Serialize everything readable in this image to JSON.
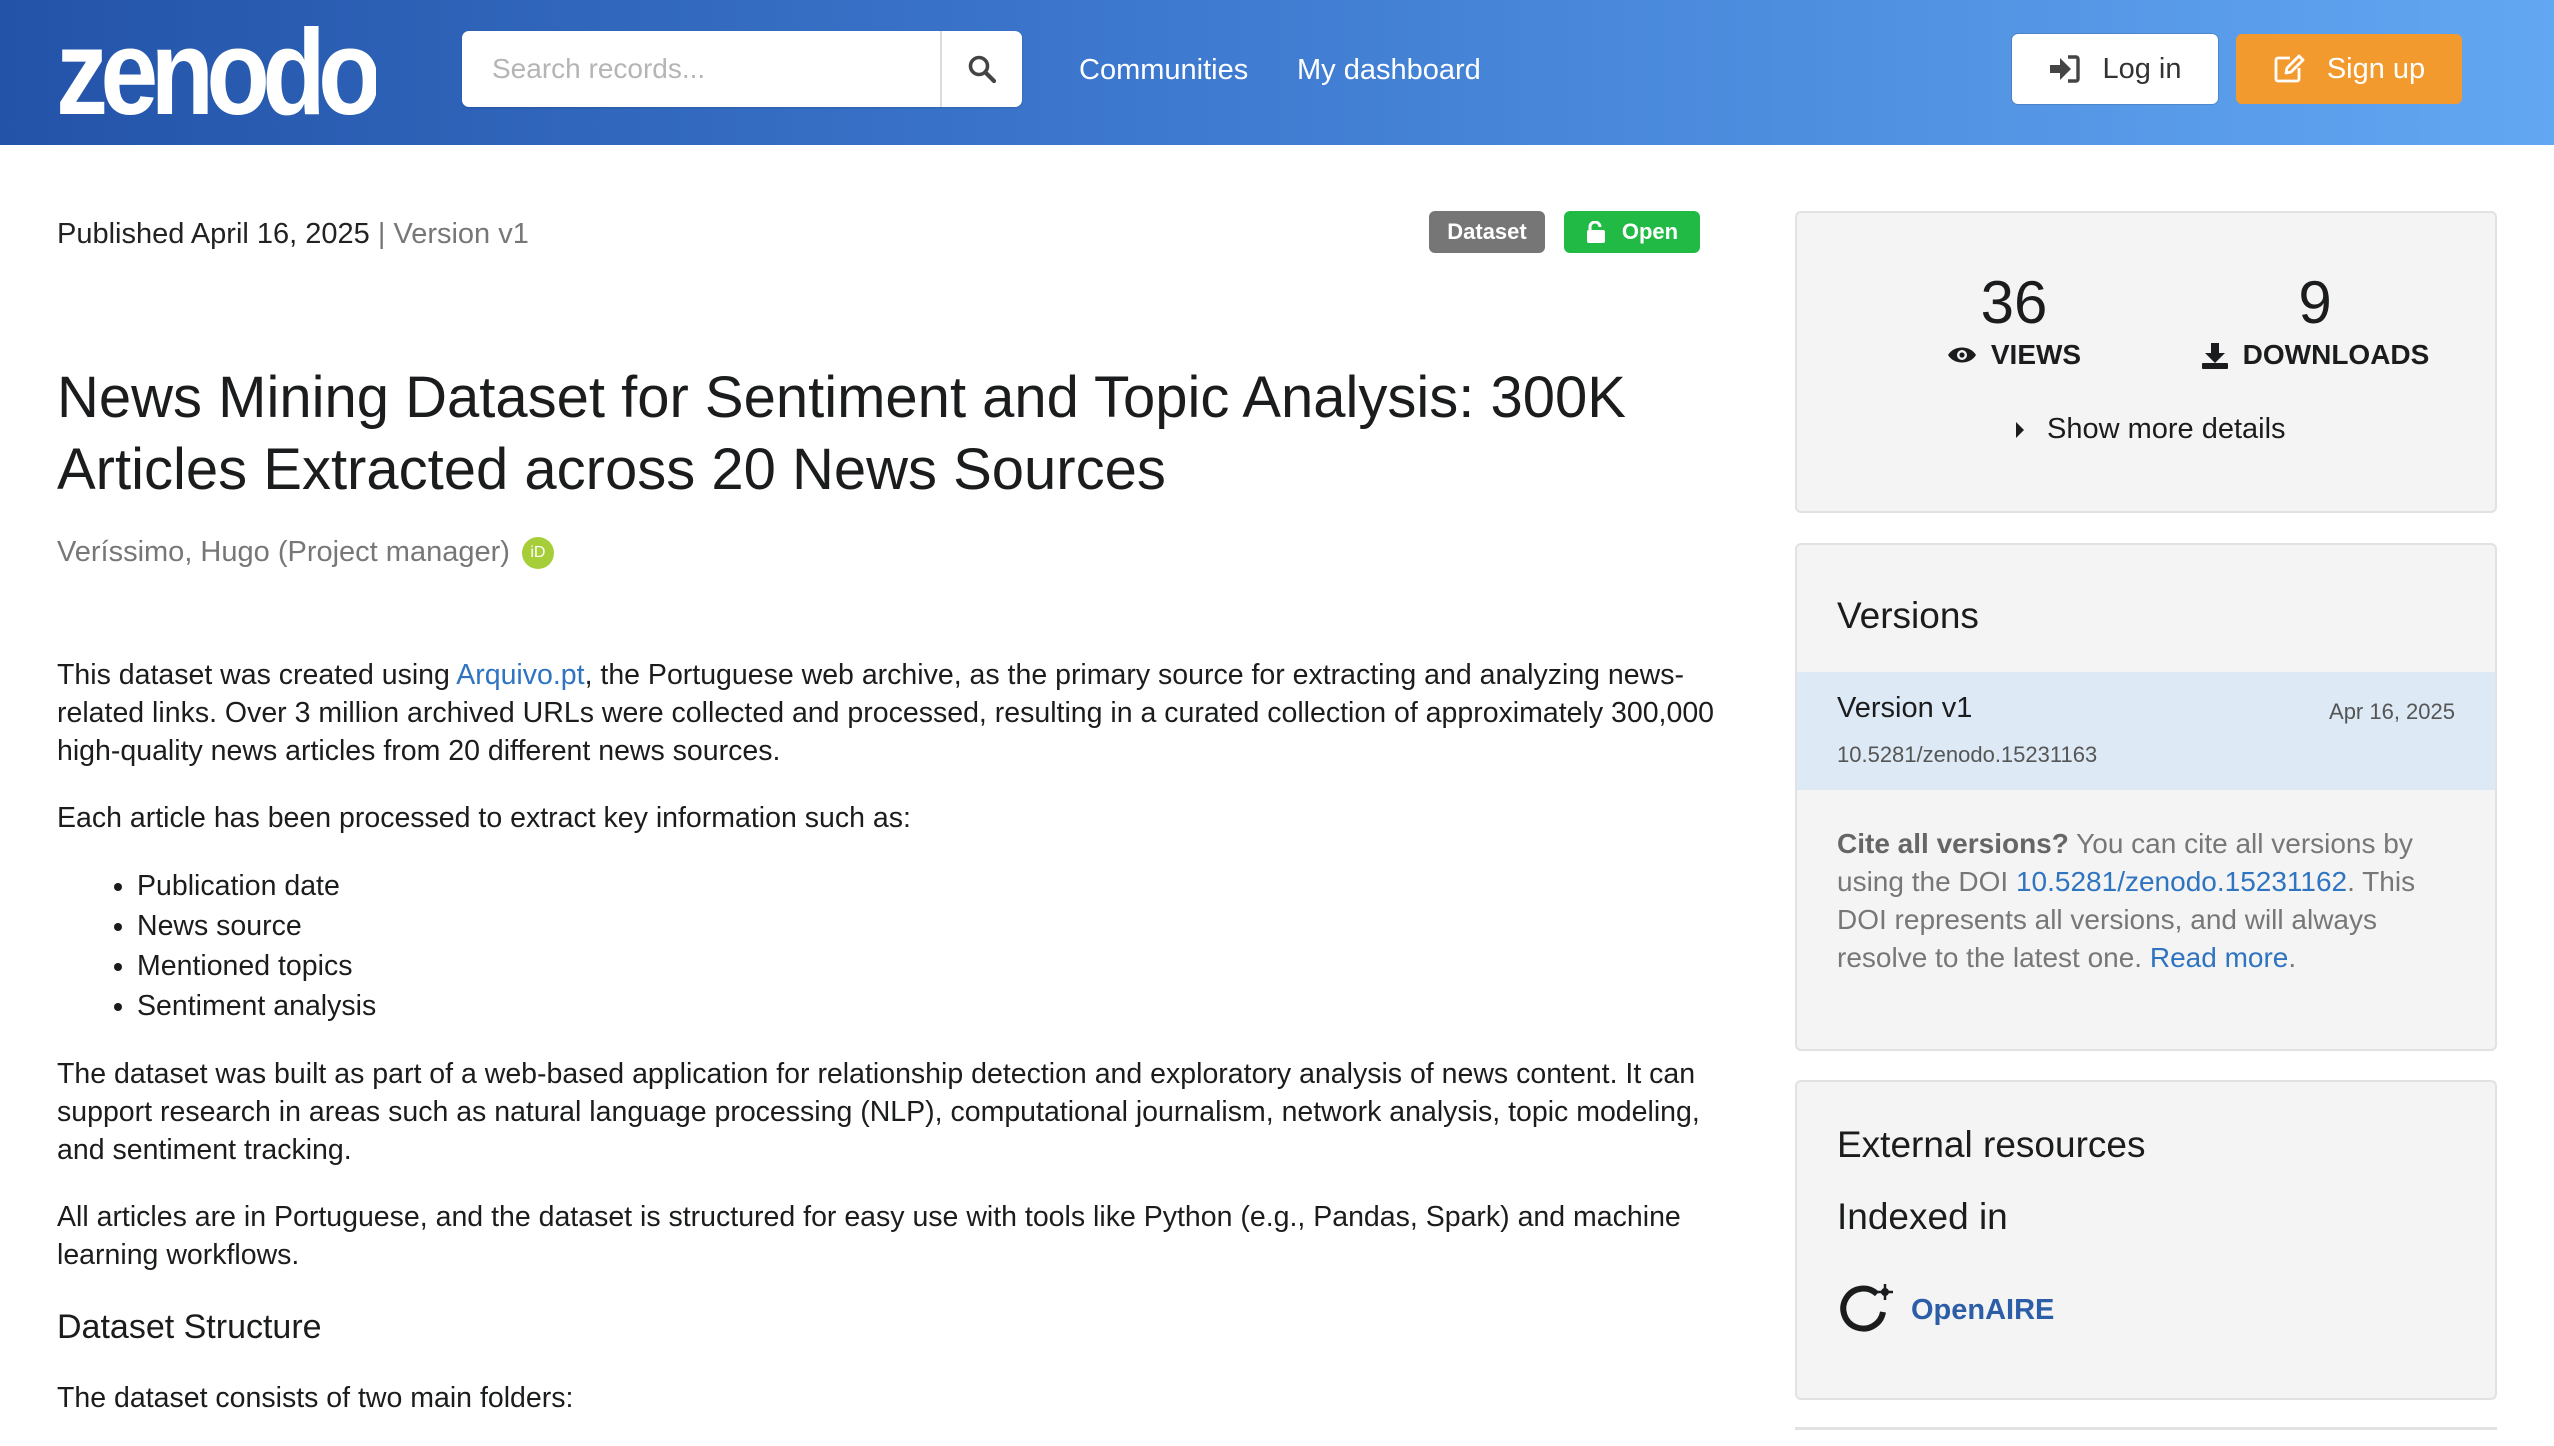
{
  "header": {
    "logo": "zenodo",
    "search_placeholder": "Search records...",
    "nav": [
      "Communities",
      "My dashboard"
    ],
    "login": "Log in",
    "signup": "Sign up"
  },
  "record": {
    "published": "Published April 16, 2025",
    "separator": " | ",
    "version": "Version v1",
    "badge_type": "Dataset",
    "badge_access": "Open",
    "title": "News Mining Dataset for Sentiment and Topic Analysis: 300K Articles Extracted across 20 News Sources",
    "creator": "Veríssimo, Hugo (Project manager)",
    "orcid_icon": "iD"
  },
  "description": {
    "p1_before": "This dataset was created using ",
    "p1_link": "Arquivo.pt",
    "p1_after": ", the Portuguese web archive, as the primary source for extracting and analyzing news-related links. Over 3 million archived URLs were collected and processed, resulting in a curated collection of approximately 300,000 high-quality news articles from 20 different news sources.",
    "p2": "Each article has been processed to extract key information such as:",
    "list": [
      "Publication date",
      "News source",
      "Mentioned topics",
      "Sentiment analysis"
    ],
    "p3": "The dataset was built as part of a web-based application for relationship detection and exploratory analysis of news content. It can support research in areas such as natural language processing (NLP), computational journalism, network analysis, topic modeling, and sentiment tracking.",
    "p4": "All articles are in Portuguese, and the dataset is structured for easy use with tools like Python (e.g., Pandas, Spark) and machine learning workflows.",
    "h_structure": "Dataset Structure",
    "p5": "The dataset consists of two main folders:"
  },
  "stats": {
    "views": "36",
    "views_label": "VIEWS",
    "downloads": "9",
    "downloads_label": "DOWNLOADS",
    "show_more": "Show more details"
  },
  "versions": {
    "heading": "Versions",
    "name": "Version v1",
    "date": "Apr 16, 2025",
    "doi": "10.5281/zenodo.15231163",
    "cite_bold": "Cite all versions?",
    "cite_1": " You can cite all versions by using the DOI ",
    "cite_doi": "10.5281/zenodo.15231162",
    "cite_2": ". This DOI represents all versions, and will always resolve to the latest one. ",
    "read_more": "Read more",
    "period": "."
  },
  "external": {
    "heading": "External resources",
    "indexed": "Indexed in",
    "openaire": "OpenAIRE"
  },
  "colors": {
    "header_start": "#2353a8",
    "header_end": "#62a7f2",
    "signup": "#f39a2e",
    "open_badge": "#21ba45",
    "dataset_badge": "#767676",
    "link": "#2f74c0",
    "version_highlight": "#dde9f5"
  }
}
